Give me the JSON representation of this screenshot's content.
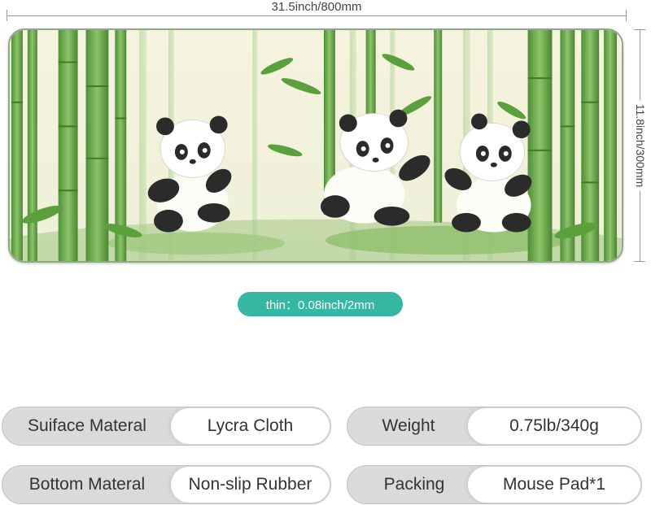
{
  "dimensions": {
    "width_label": "31.5inch/800mm",
    "height_label": "11.8inch/300mm"
  },
  "thickness_label": "thin：0.08inch/2mm",
  "specs": [
    {
      "label": "Suiface Materal",
      "value": "Lycra Cloth"
    },
    {
      "label": "Weight",
      "value": "0.75lb/340g"
    },
    {
      "label": "Bottom Materal",
      "value": "Non-slip Rubber"
    },
    {
      "label": "Packing",
      "value": "Mouse Pad*1"
    }
  ],
  "illustration": {
    "subject": "three cartoon pandas eating bamboo in a bamboo forest",
    "colors": {
      "bamboo": "#6aa84f",
      "background": "#f3f0dc",
      "accent": "#35b7a2"
    }
  }
}
